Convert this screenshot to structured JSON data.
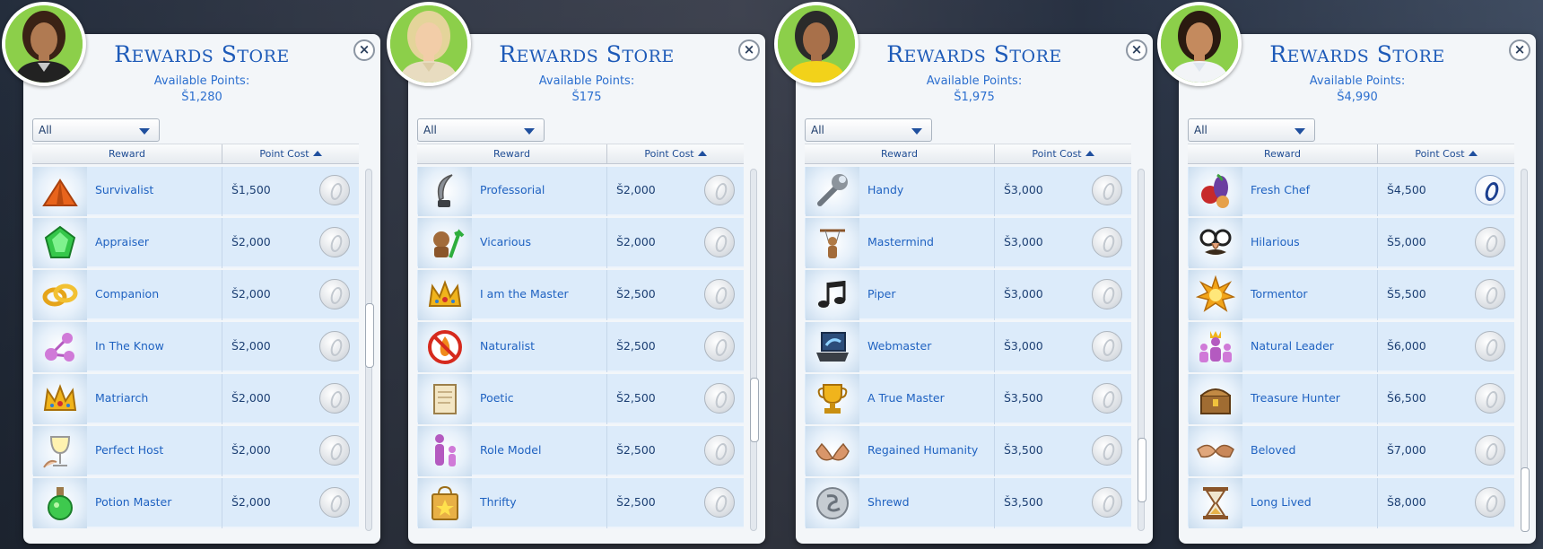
{
  "panels": [
    {
      "title": "Rewards Store",
      "points_label": "Available Points:",
      "points_value": "Š1,280",
      "filter_value": "All",
      "col_reward": "Reward",
      "col_cost": "Point Cost",
      "scroll_position": 0.45,
      "rows": [
        {
          "name": "Survivalist",
          "cost": "Š1,500",
          "icon": "orange-tent-icon",
          "affordable": false
        },
        {
          "name": "Appraiser",
          "cost": "Š2,000",
          "icon": "green-gem-icon",
          "affordable": false
        },
        {
          "name": "Companion",
          "cost": "Š2,000",
          "icon": "gold-rings-icon",
          "affordable": false
        },
        {
          "name": "In The Know",
          "cost": "Š2,000",
          "icon": "pink-network-icon",
          "affordable": false
        },
        {
          "name": "Matriarch",
          "cost": "Š2,000",
          "icon": "gold-crown-icon",
          "affordable": false
        },
        {
          "name": "Perfect Host",
          "cost": "Š2,000",
          "icon": "wine-glass-icon",
          "affordable": false
        },
        {
          "name": "Potion Master",
          "cost": "Š2,000",
          "icon": "green-potion-icon",
          "affordable": false
        }
      ]
    },
    {
      "title": "Rewards Store",
      "points_label": "Available Points:",
      "points_value": "Š175",
      "filter_value": "All",
      "col_reward": "Reward",
      "col_cost": "Point Cost",
      "scroll_position": 0.7,
      "rows": [
        {
          "name": "Professorial",
          "cost": "Š2,000",
          "icon": "quill-icon",
          "affordable": false
        },
        {
          "name": "Vicarious",
          "cost": "Š2,000",
          "icon": "puppet-arrow-icon",
          "affordable": false
        },
        {
          "name": "I am the Master",
          "cost": "Š2,500",
          "icon": "gold-crown-icon",
          "affordable": false
        },
        {
          "name": "Naturalist",
          "cost": "Š2,500",
          "icon": "no-fire-icon",
          "affordable": false
        },
        {
          "name": "Poetic",
          "cost": "Š2,500",
          "icon": "scroll-icon",
          "affordable": false
        },
        {
          "name": "Role Model",
          "cost": "Š2,500",
          "icon": "parent-child-icon",
          "affordable": false
        },
        {
          "name": "Thrifty",
          "cost": "Š2,500",
          "icon": "shopping-bag-icon",
          "affordable": false
        }
      ]
    },
    {
      "title": "Rewards Store",
      "points_label": "Available Points:",
      "points_value": "Š1,975",
      "filter_value": "All",
      "col_reward": "Reward",
      "col_cost": "Point Cost",
      "scroll_position": 0.9,
      "rows": [
        {
          "name": "Handy",
          "cost": "Š3,000",
          "icon": "wrench-icon",
          "affordable": false
        },
        {
          "name": "Mastermind",
          "cost": "Š3,000",
          "icon": "puppet-strings-icon",
          "affordable": false
        },
        {
          "name": "Piper",
          "cost": "Š3,000",
          "icon": "music-notes-icon",
          "affordable": false
        },
        {
          "name": "Webmaster",
          "cost": "Š3,000",
          "icon": "laptop-icon",
          "affordable": false
        },
        {
          "name": "A True Master",
          "cost": "Š3,500",
          "icon": "trophy-icon",
          "affordable": false
        },
        {
          "name": "Regained Humanity",
          "cost": "Š3,500",
          "icon": "open-hands-icon",
          "affordable": false
        },
        {
          "name": "Shrewd",
          "cost": "Š3,500",
          "icon": "silver-coin-icon",
          "affordable": false
        }
      ]
    },
    {
      "title": "Rewards Store",
      "points_label": "Available Points:",
      "points_value": "Š4,990",
      "filter_value": "All",
      "col_reward": "Reward",
      "col_cost": "Point Cost",
      "scroll_position": 1.0,
      "rows": [
        {
          "name": "Fresh Chef",
          "cost": "Š4,500",
          "icon": "vegetables-icon",
          "affordable": true
        },
        {
          "name": "Hilarious",
          "cost": "Š5,000",
          "icon": "groucho-glasses-icon",
          "affordable": false
        },
        {
          "name": "Tormentor",
          "cost": "Š5,500",
          "icon": "burst-icon",
          "affordable": false
        },
        {
          "name": "Natural Leader",
          "cost": "Š6,000",
          "icon": "leader-group-icon",
          "affordable": false
        },
        {
          "name": "Treasure Hunter",
          "cost": "Š6,500",
          "icon": "treasure-chest-icon",
          "affordable": false
        },
        {
          "name": "Beloved",
          "cost": "Š7,000",
          "icon": "holding-hands-icon",
          "affordable": false
        },
        {
          "name": "Long Lived",
          "cost": "Š8,000",
          "icon": "hourglass-icon",
          "affordable": false
        }
      ]
    }
  ]
}
